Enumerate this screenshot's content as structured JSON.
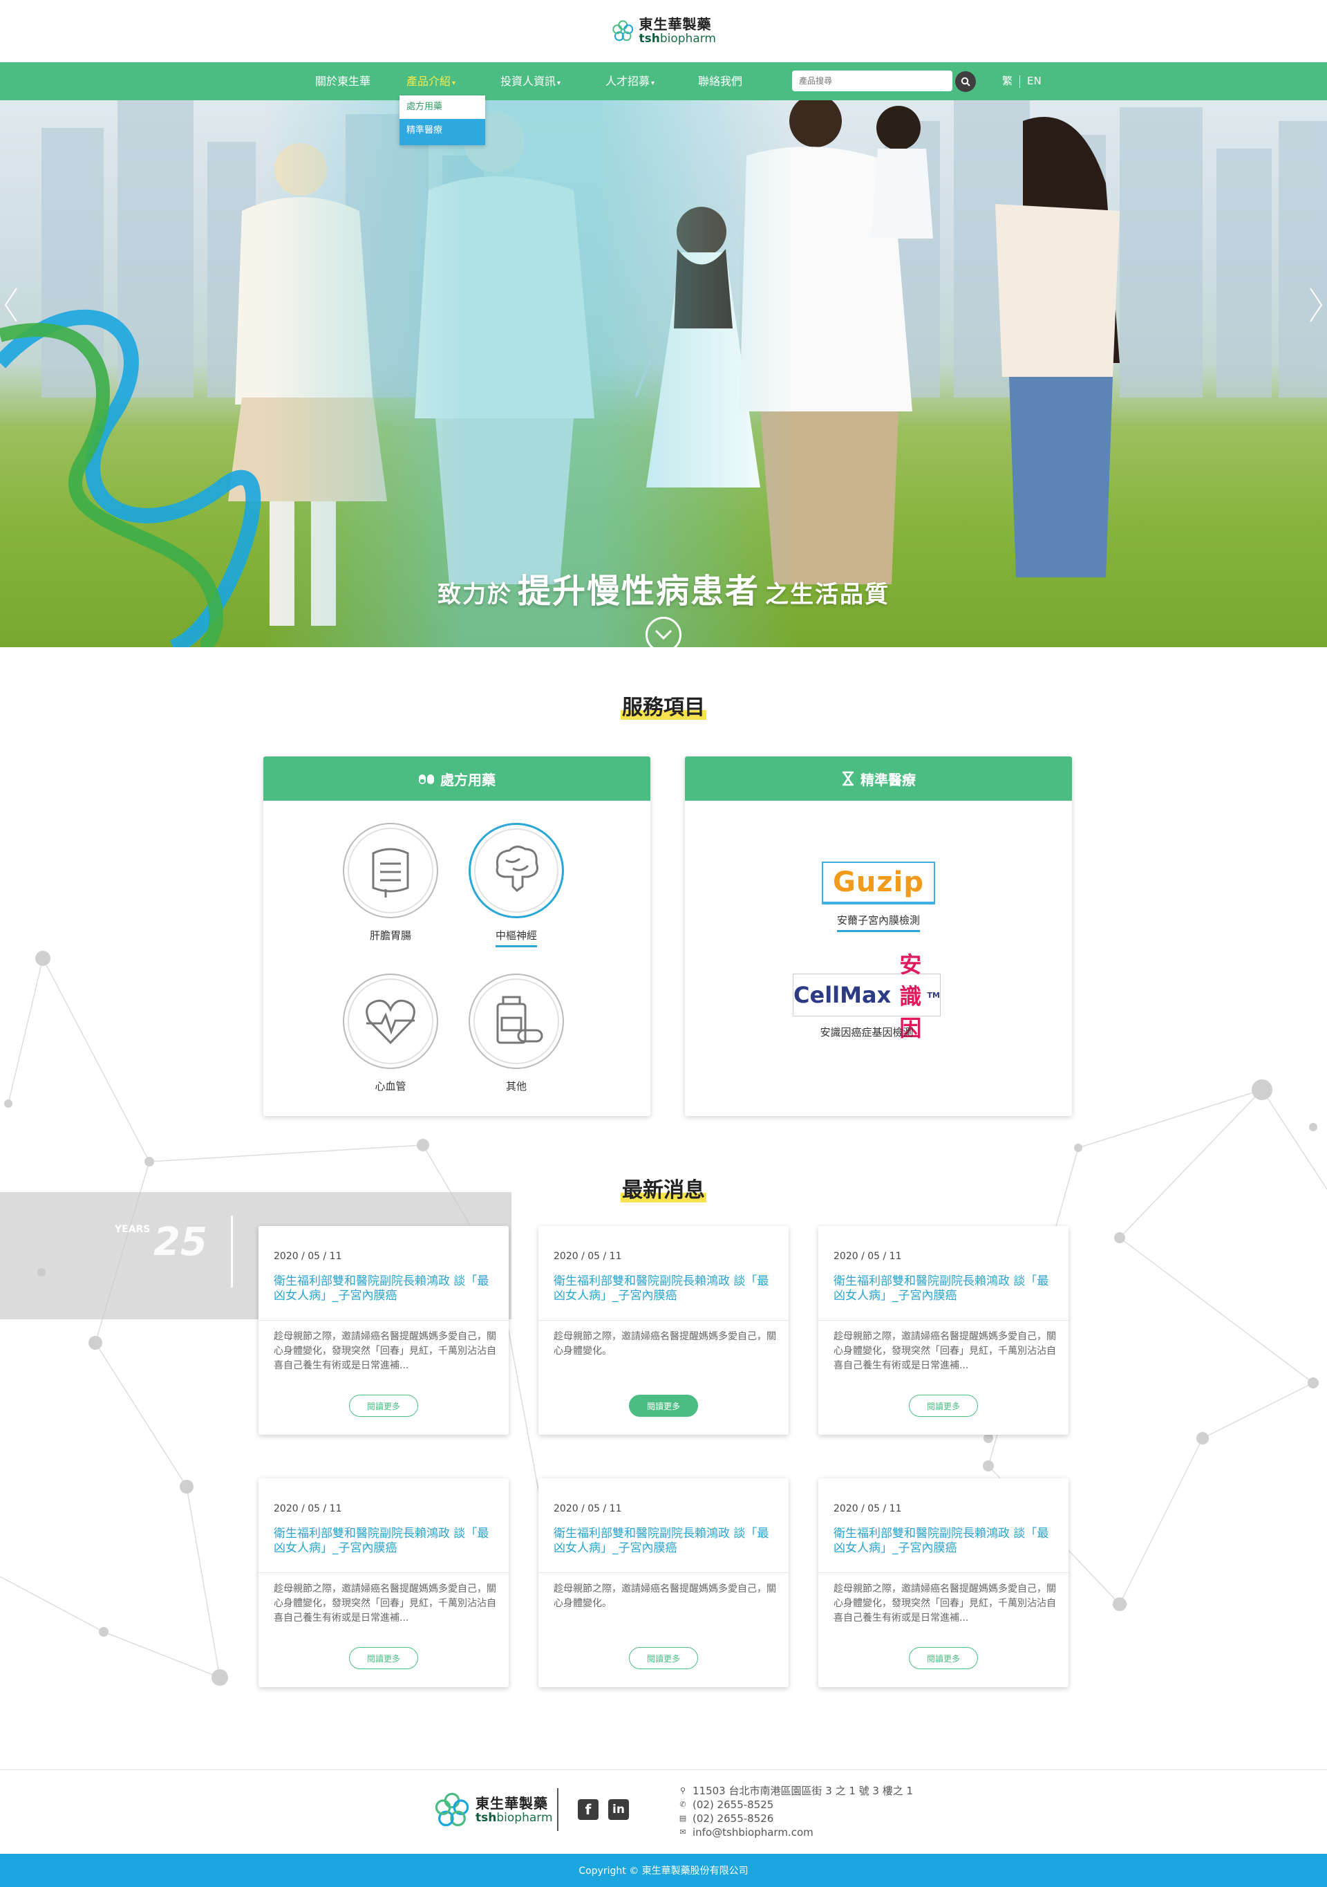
{
  "brand": {
    "name_zh": "東生華製藥",
    "name_en_bold": "tsh",
    "name_en_rest": "biopharm"
  },
  "nav": {
    "items": [
      {
        "label": "關於東生華",
        "caret": false
      },
      {
        "label": "產品介紹",
        "caret": true
      },
      {
        "label": "投資人資訊",
        "caret": true
      },
      {
        "label": "人才招募",
        "caret": true
      },
      {
        "label": "聯絡我們",
        "caret": false
      }
    ],
    "active_index": 1,
    "search_placeholder": "產品搜尋",
    "lang_zh": "繁",
    "lang_en": "EN",
    "dropdown": [
      {
        "label": "處方用藥",
        "selected": false
      },
      {
        "label": "精準醫療",
        "selected": true
      }
    ]
  },
  "hero": {
    "caption_pre": "致力於",
    "caption_big": "提升慢性病患者",
    "caption_post": "之生活品質"
  },
  "services": {
    "title": "服務項目",
    "prescription": {
      "title": "處方用藥",
      "icon": "pills-icon",
      "categories": [
        {
          "label": "肝膽胃腸",
          "icon": "intestine-icon",
          "active": false
        },
        {
          "label": "中樞神經",
          "icon": "brain-icon",
          "active": true
        },
        {
          "label": "心血管",
          "icon": "heart-pulse-icon",
          "active": false
        },
        {
          "label": "其他",
          "icon": "medicine-bottle-icon",
          "active": false
        }
      ]
    },
    "precision": {
      "title": "精準醫療",
      "icon": "dna-icon",
      "brands": [
        {
          "logo_text": "Guzip",
          "label": "安薾子宮內膜檢測",
          "active": true
        },
        {
          "logo_text": "CellMax",
          "logo_text_zh": "安識因",
          "logo_tm": "TM",
          "label": "安識因癌症基因檢測",
          "active": false
        }
      ]
    }
  },
  "banner25": {
    "number": "25",
    "word": "YEARS"
  },
  "news": {
    "title": "最新消息",
    "read_more": "閱讀更多",
    "items": [
      {
        "date": "2020 / 05 / 11",
        "title": "衛生福利部雙和醫院副院長賴鴻政 談「最凶女人病」_子宮內膜癌",
        "excerpt": "趁母親節之際，邀請婦癌名醫提醒媽媽多愛自己，關心身體變化，發現突然「回春」見紅，千萬別沾沾自喜自己養生有術或是日常進補...",
        "btn_filled": false
      },
      {
        "date": "2020 / 05 / 11",
        "title": "衛生福利部雙和醫院副院長賴鴻政 談「最凶女人病」_子宮內膜癌",
        "excerpt": "趁母親節之際，邀請婦癌名醫提醒媽媽多愛自己，關心身體變化。",
        "btn_filled": true
      },
      {
        "date": "2020 / 05 / 11",
        "title": "衛生福利部雙和醫院副院長賴鴻政 談「最凶女人病」_子宮內膜癌",
        "excerpt": "趁母親節之際，邀請婦癌名醫提醒媽媽多愛自己，關心身體變化，發現突然「回春」見紅，千萬別沾沾自喜自己養生有術或是日常進補...",
        "btn_filled": false
      },
      {
        "date": "2020 / 05 / 11",
        "title": "衛生福利部雙和醫院副院長賴鴻政 談「最凶女人病」_子宮內膜癌",
        "excerpt": "趁母親節之際，邀請婦癌名醫提醒媽媽多愛自己，關心身體變化，發現突然「回春」見紅，千萬別沾沾自喜自己養生有術或是日常進補...",
        "btn_filled": false
      },
      {
        "date": "2020 / 05 / 11",
        "title": "衛生福利部雙和醫院副院長賴鴻政 談「最凶女人病」_子宮內膜癌",
        "excerpt": "趁母親節之際，邀請婦癌名醫提醒媽媽多愛自己，關心身體變化。",
        "btn_filled": false
      },
      {
        "date": "2020 / 05 / 11",
        "title": "衛生福利部雙和醫院副院長賴鴻政 談「最凶女人病」_子宮內膜癌",
        "excerpt": "趁母親節之際，邀請婦癌名醫提醒媽媽多愛自己，關心身體變化，發現突然「回春」見紅，千萬別沾沾自喜自己養生有術或是日常進補...",
        "btn_filled": false
      }
    ]
  },
  "footer": {
    "address": "11503 台北市南港區園區街 3 之 1 號 3 樓之 1",
    "phone": "(02) 2655-8525",
    "fax": "(02) 2655-8526",
    "email": "info@tshbiopharm.com",
    "social": [
      "facebook-icon",
      "linkedin-icon"
    ],
    "copyright": "Copyright © 東生華製藥股份有限公司"
  },
  "colors": {
    "primary_green": "#4cbd82",
    "accent_blue": "#1ba6df",
    "nav_active": "#f4ea4e",
    "title_highlight": "#f6e24e",
    "link_blue": "#2aa4cf"
  }
}
